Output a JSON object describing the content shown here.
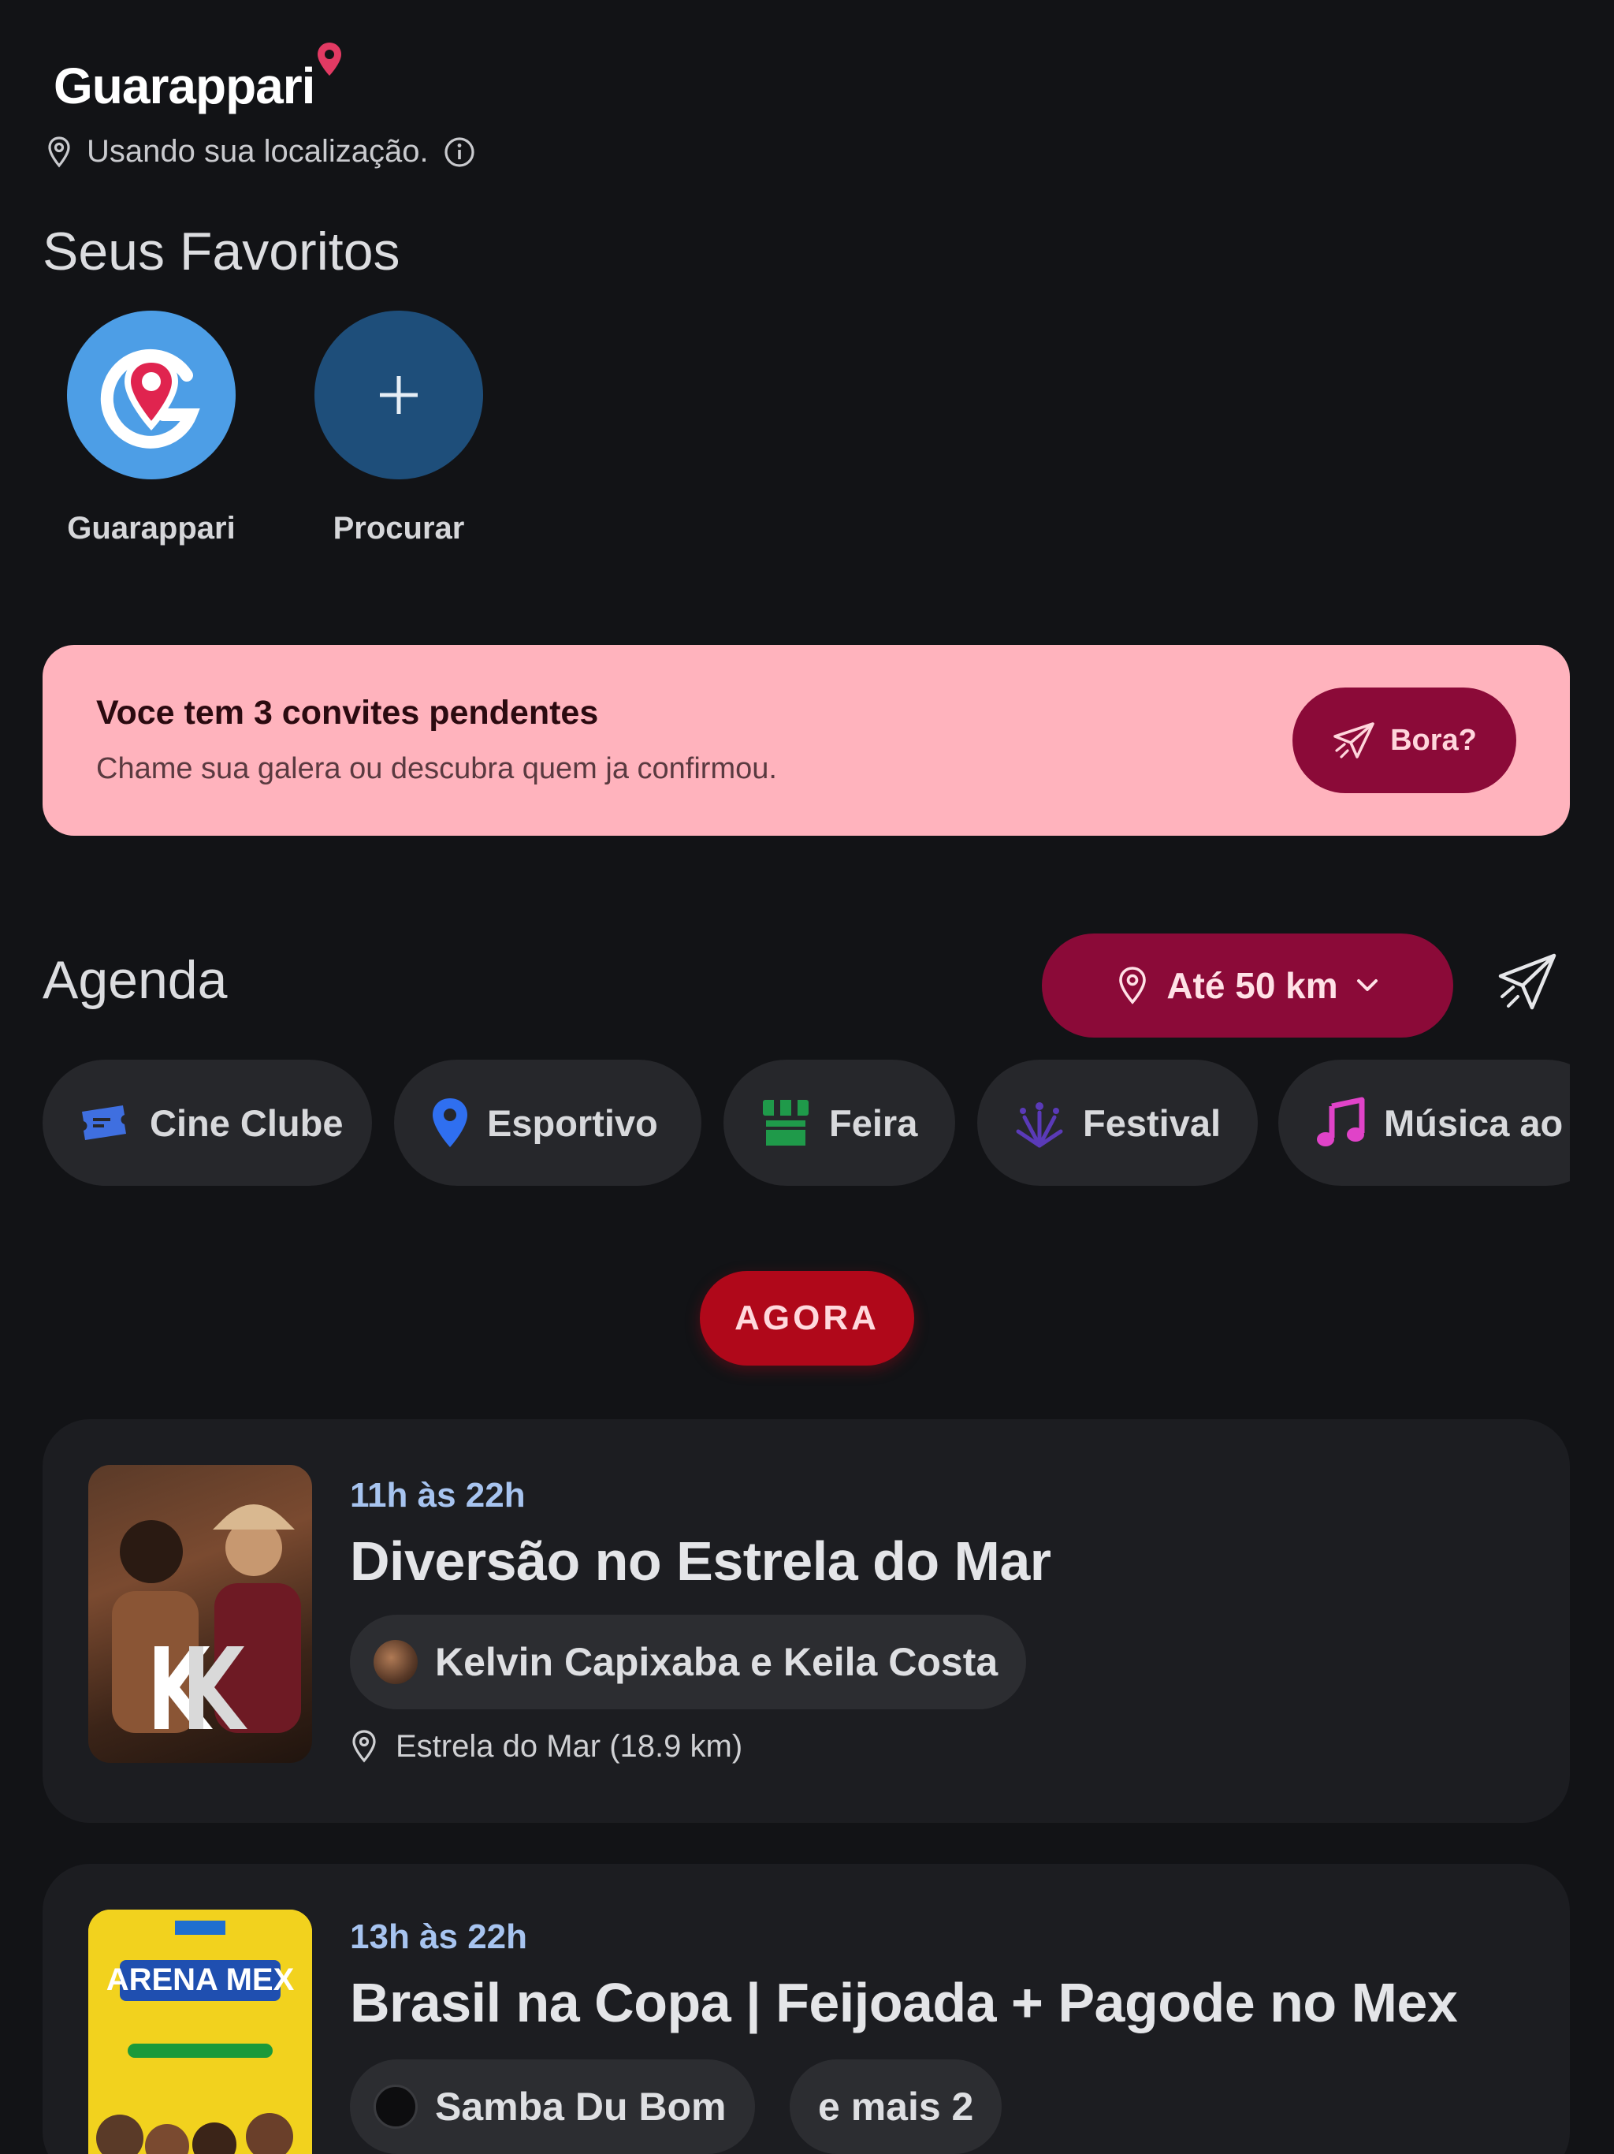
{
  "header": {
    "app_name": "Guarappari",
    "location_text": "Usando sua localização."
  },
  "favorites": {
    "title": "Seus Favoritos",
    "items": [
      {
        "label": "Guarappari",
        "icon": "guarappari-logo-icon"
      },
      {
        "label": "Procurar",
        "icon": "plus-icon"
      }
    ]
  },
  "invite": {
    "title": "Voce tem 3 convites pendentes",
    "subtitle": "Chame sua galera ou descubra quem ja confirmou.",
    "button_label": "Bora?"
  },
  "agenda": {
    "title": "Agenda",
    "range_label": "Até 50 km",
    "categories": [
      {
        "label": "Cine Clube",
        "icon": "ticket-icon",
        "color": "#3f6fe0"
      },
      {
        "label": "Esportivo",
        "icon": "map-pin-icon",
        "color": "#2f6ff0"
      },
      {
        "label": "Feira",
        "icon": "market-stall-icon",
        "color": "#1f9a4a"
      },
      {
        "label": "Festival",
        "icon": "fireworks-icon",
        "color": "#5a3ab8"
      },
      {
        "label": "Música ao",
        "icon": "music-note-icon",
        "color": "#e043c8"
      }
    ],
    "now_label": "AGORA"
  },
  "events": [
    {
      "time": "11h às 22h",
      "title": "Diversão no Estrela do Mar",
      "artist": "Kelvin Capixaba e Keila Costa",
      "venue": "Estrela do Mar (18.9 km)"
    },
    {
      "time": "13h às 22h",
      "title": "Brasil na Copa | Feijoada + Pagode  no Mex",
      "artist": "Samba Du Bom",
      "more": "e mais 2",
      "poster_text": "ARENA MEX"
    }
  ],
  "colors": {
    "background": "#121316",
    "accent": "#8b0a38",
    "invite_bg": "#ffb3bd",
    "now_pill": "#b0081a",
    "time_text": "#a7c4f0"
  }
}
